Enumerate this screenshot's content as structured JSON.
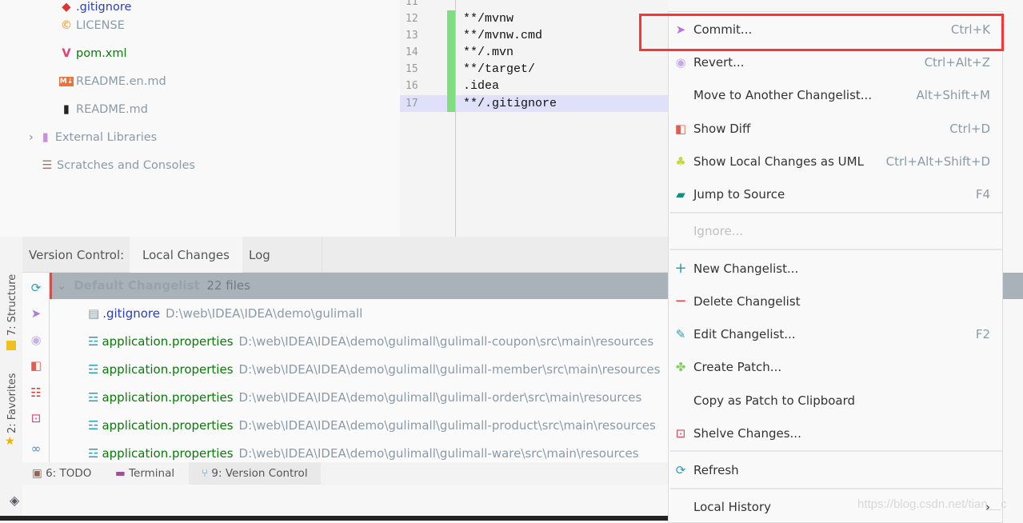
{
  "project_tree": [
    {
      "label": ".gitignore",
      "icon": "git-ignore-icon",
      "color": "#2a3fbf"
    },
    {
      "label": "LICENSE",
      "icon": "license-icon",
      "color": "#8a9aa8"
    },
    {
      "label": "pom.xml",
      "icon": "maven-icon",
      "color": "#0a7a0a"
    },
    {
      "label": "README.en.md",
      "icon": "markdown-icon",
      "color": "#8a9aa8"
    },
    {
      "label": "README.md",
      "icon": "book-icon",
      "color": "#8a9aa8"
    },
    {
      "label": "External Libraries",
      "icon": "library-icon",
      "color": "#8a9aa8"
    },
    {
      "label": "Scratches and Consoles",
      "icon": "scratches-icon",
      "color": "#8a9aa8"
    }
  ],
  "editor": {
    "lines": [
      {
        "n": "11",
        "code": ""
      },
      {
        "n": "12",
        "code": "**/mvnw"
      },
      {
        "n": "13",
        "code": "**/mvnw.cmd"
      },
      {
        "n": "14",
        "code": "**/.mvn"
      },
      {
        "n": "15",
        "code": "**/target/"
      },
      {
        "n": "16",
        "code": ".idea"
      },
      {
        "n": "17",
        "code": "**/.gitignore"
      }
    ]
  },
  "version_control": {
    "label": "Version Control:",
    "tabs": [
      "Local Changes",
      "Log"
    ],
    "active_tab": "Local Changes",
    "changelist": {
      "name": "Default Changelist",
      "count": "22 files"
    },
    "files": [
      {
        "name": ".gitignore",
        "path": "D:\\web\\IDEA\\IDEA\\demo\\gulimall",
        "color": "#2a3fbf"
      },
      {
        "name": "application.properties",
        "path": "D:\\web\\IDEA\\IDEA\\demo\\gulimall\\gulimall-coupon\\src\\main\\resources",
        "color": "#0a7a0a"
      },
      {
        "name": "application.properties",
        "path": "D:\\web\\IDEA\\IDEA\\demo\\gulimall\\gulimall-member\\src\\main\\resources",
        "color": "#0a7a0a"
      },
      {
        "name": "application.properties",
        "path": "D:\\web\\IDEA\\IDEA\\demo\\gulimall\\gulimall-order\\src\\main\\resources",
        "color": "#0a7a0a"
      },
      {
        "name": "application.properties",
        "path": "D:\\web\\IDEA\\IDEA\\demo\\gulimall\\gulimall-product\\src\\main\\resources",
        "color": "#0a7a0a"
      },
      {
        "name": "application.properties",
        "path": "D:\\web\\IDEA\\IDEA\\demo\\gulimall\\gulimall-ware\\src\\main\\resources",
        "color": "#0a7a0a"
      }
    ]
  },
  "side_tabs": {
    "structure": "7: Structure",
    "favorites": "2: Favorites"
  },
  "bottom_tabs": [
    "6: TODO",
    "Terminal",
    "9: Version Control"
  ],
  "context_menu": [
    {
      "label": "Commit...",
      "shortcut": "Ctrl+K",
      "icon": "commit-icon"
    },
    {
      "label": "Revert...",
      "shortcut": "Ctrl+Alt+Z",
      "icon": "revert-icon"
    },
    {
      "label": "Move to Another Changelist...",
      "shortcut": "Alt+Shift+M",
      "icon": ""
    },
    {
      "label": "Show Diff",
      "shortcut": "Ctrl+D",
      "icon": "diff-icon"
    },
    {
      "label": "Show Local Changes as UML",
      "shortcut": "Ctrl+Alt+Shift+D",
      "icon": "uml-icon"
    },
    {
      "label": "Jump to Source",
      "shortcut": "F4",
      "icon": "jump-source-icon"
    },
    {
      "label": "Ignore...",
      "shortcut": "",
      "icon": "",
      "disabled": true
    },
    {
      "label": "New Changelist...",
      "shortcut": "",
      "icon": "plus-icon"
    },
    {
      "label": "Delete Changelist",
      "shortcut": "",
      "icon": "minus-icon"
    },
    {
      "label": "Edit Changelist...",
      "shortcut": "F2",
      "icon": "pencil-icon"
    },
    {
      "label": "Create Patch...",
      "shortcut": "",
      "icon": "patch-icon"
    },
    {
      "label": "Copy as Patch to Clipboard",
      "shortcut": "",
      "icon": ""
    },
    {
      "label": "Shelve Changes...",
      "shortcut": "",
      "icon": "shelve-icon"
    },
    {
      "label": "Refresh",
      "shortcut": "",
      "icon": "refresh-icon"
    },
    {
      "label": "Local History",
      "shortcut": "",
      "icon": "",
      "submenu": true
    }
  ],
  "watermark": "https://blog.csdn.net/tian__c"
}
